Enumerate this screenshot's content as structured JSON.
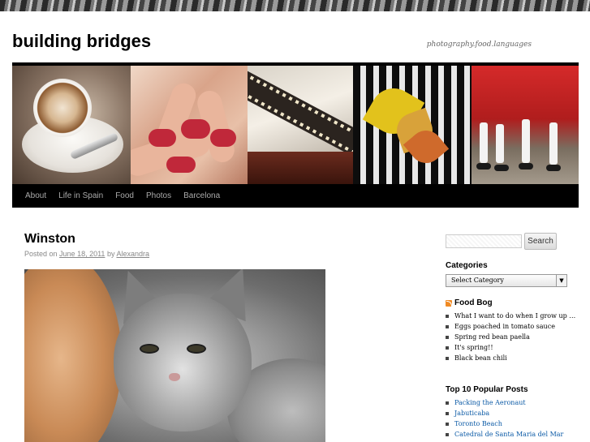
{
  "site": {
    "title": "building bridges",
    "tagline": "photography.food.languages"
  },
  "nav": {
    "items": [
      {
        "label": "About"
      },
      {
        "label": "Life in Spain"
      },
      {
        "label": "Food"
      },
      {
        "label": "Photos"
      },
      {
        "label": "Barcelona"
      }
    ]
  },
  "post": {
    "title": "Winston",
    "meta_prefix": "Posted on",
    "date": "June 18, 2011",
    "by": "by",
    "author": "Alexandra"
  },
  "sidebar": {
    "search": {
      "placeholder": "",
      "button_label": "Search"
    },
    "categories": {
      "title": "Categories",
      "selected": "Select Category"
    },
    "food_bog": {
      "title": "Food Bog",
      "items": [
        "What I want to do when I grow up …",
        "Eggs poached in tomato sauce",
        "Spring red bean paella",
        "It's spring!!",
        "Black bean chili"
      ]
    },
    "popular": {
      "title": "Top 10 Popular Posts",
      "items": [
        "Packing the Aeronaut",
        "Jabuticaba",
        "Toronto Beach",
        "Catedral de Santa Maria del Mar"
      ]
    }
  },
  "colors": {
    "nav_bg": "#000000",
    "nav_text": "#aaaaaa",
    "link": "#0b5aa6",
    "rss": "#f08a24"
  }
}
